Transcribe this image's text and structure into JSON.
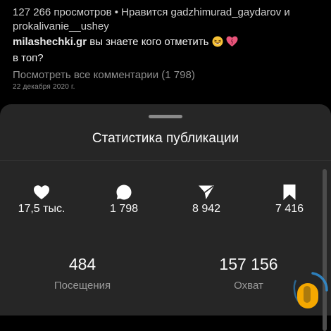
{
  "post": {
    "likes_line": "127 266 просмотров • Нравится gadzhimurad_gaydarov и prokalivanie__ushey",
    "comment_user": "milashechki.gr",
    "comment_text": "вы знаете кого отметить",
    "comment_text_cont": "в топ?",
    "comment_emojis": [
      "laughing-emoji",
      "heart-emoji"
    ],
    "view_all": "Посмотреть все комментарии (1 798)",
    "date": "22 декабря 2020 г."
  },
  "sheet": {
    "title": "Статистика публикации",
    "stats": [
      {
        "icon": "heart-icon",
        "value": "17,5 тыс."
      },
      {
        "icon": "comment-icon",
        "value": "1 798"
      },
      {
        "icon": "share-icon",
        "value": "8 942"
      },
      {
        "icon": "bookmark-icon",
        "value": "7 416"
      }
    ],
    "summary": [
      {
        "value": "484",
        "label": "Посещения"
      },
      {
        "value": "157 156",
        "label": "Охват"
      }
    ]
  },
  "colors": {
    "background": "#000000",
    "sheet": "#262626",
    "secondary_text": "#8e8e8e",
    "watermark_orange": "#f5a800",
    "watermark_blue": "#2f8fd6"
  }
}
